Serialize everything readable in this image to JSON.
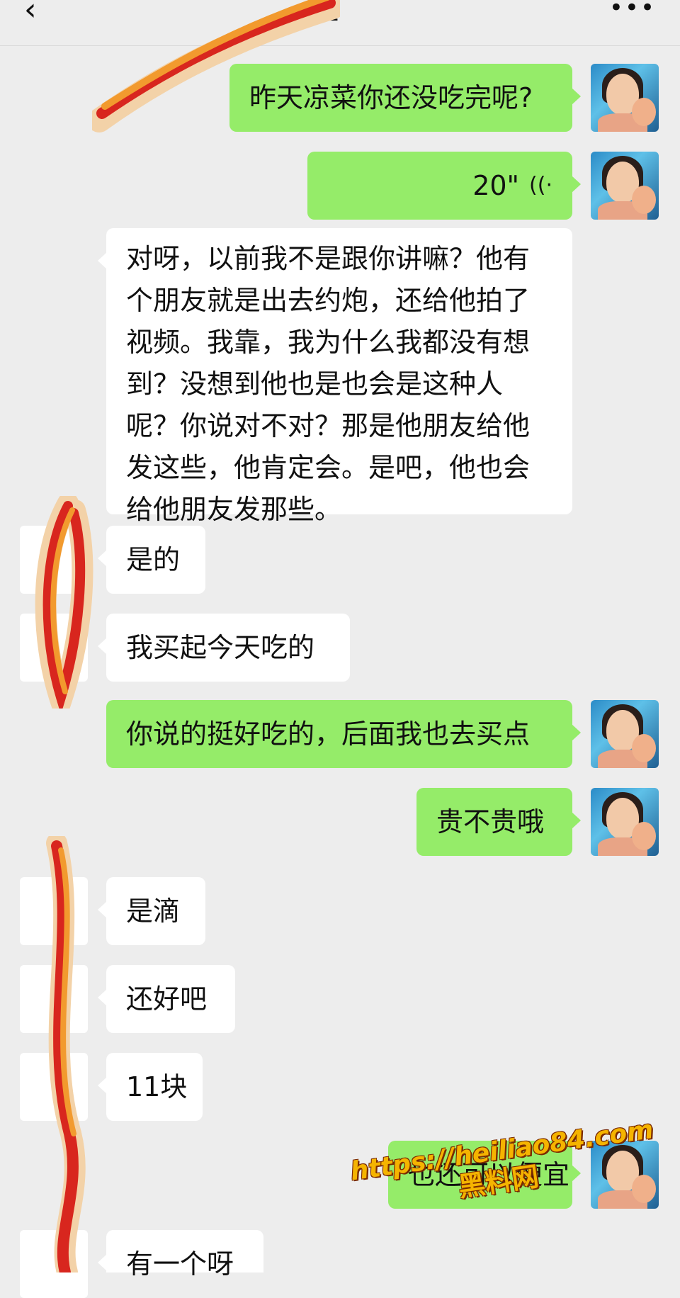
{
  "header": {
    "back_icon": "chevron-left-icon",
    "title": "姐",
    "more_icon": "more-dots-icon",
    "more_glyph": "•••"
  },
  "messages": [
    {
      "side": "right",
      "type": "text",
      "text": "昨天凉菜你还没吃完呢?"
    },
    {
      "side": "right",
      "type": "voice",
      "duration": "20\"",
      "icon": "voice-wave-icon"
    },
    {
      "side": "left",
      "type": "text",
      "text": "对呀，以前我不是跟你讲嘛？他有个朋友就是出去约炮，还给他拍了视频。我靠，我为什么我都没有想到？没想到他也是也会是这种人呢？你说对不对？那是他朋友给他发这些，他肯定会。是吧，他也会给他朋友发那些。"
    },
    {
      "side": "left",
      "type": "text",
      "text": "是的"
    },
    {
      "side": "left",
      "type": "text",
      "text": "我买起今天吃的"
    },
    {
      "side": "right",
      "type": "text",
      "text": "你说的挺好吃的，后面我也去买点"
    },
    {
      "side": "right",
      "type": "text",
      "text": "贵不贵哦"
    },
    {
      "side": "left",
      "type": "text",
      "text": "是滴"
    },
    {
      "side": "left",
      "type": "text",
      "text": "还好吧"
    },
    {
      "side": "left",
      "type": "text",
      "text": "11块"
    },
    {
      "side": "right",
      "type": "text",
      "text": "也还可以便宜"
    },
    {
      "side": "left",
      "type": "text",
      "text": "有一个呀"
    }
  ],
  "watermark": {
    "url": "https://heiliao84.com",
    "text": "黑料网"
  },
  "colors": {
    "background": "#ededed",
    "bubble_outgoing": "#95ec69",
    "bubble_incoming": "#ffffff",
    "watermark": "#f5b400",
    "scribble_red": "#d8261e",
    "scribble_orange": "#f29a2e"
  }
}
